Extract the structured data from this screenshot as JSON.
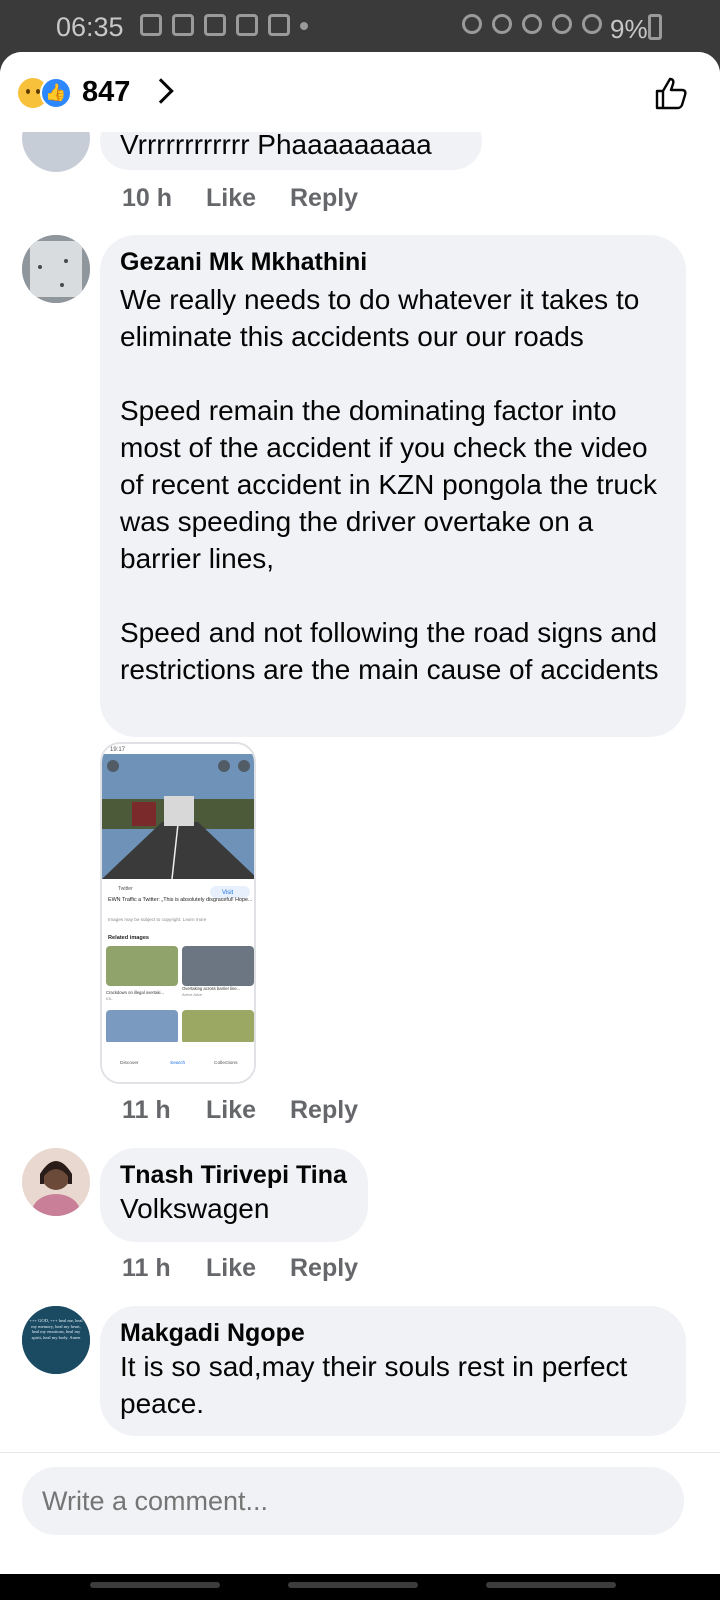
{
  "status_bar": {
    "time": "06:35",
    "battery": "9%"
  },
  "header": {
    "reaction_count": "847"
  },
  "comments": [
    {
      "name": "",
      "text": "Vrrrrrrrrrrrr Phaaaaaaaaa",
      "time": "10 h"
    },
    {
      "name": "Gezani Mk Mkhathini",
      "text": "We really needs to do whatever it takes to eliminate this accidents our our roads\n\nSpeed remain the dominating factor into most of the accident if you check the video of recent accident in KZN pongola the truck was speeding the driver overtake on a barrier lines,\n\nSpeed and not following the road signs and restrictions are the main cause of accidents",
      "time": "11 h"
    },
    {
      "name": "Tnash Tirivepi Tina",
      "text": "Volkswagen",
      "time": "11 h"
    },
    {
      "name": "Makgadi Ngope",
      "text": "It is so sad,may their souls rest in perfect peace."
    }
  ],
  "actions": {
    "like": "Like",
    "reply": "Reply"
  },
  "attachment": {
    "status_time": "19:17",
    "source": "Twitter",
    "caption": "EWN Traffic a Twitter: „This is absolutely disgraceful! Hope...",
    "visit": "Visit",
    "copyright": "Images may be subject to copyright. Learn more",
    "related_title": "Related images",
    "related_1": "Crackdown on illegal overtaki...",
    "related_1_src": "IOL",
    "related_2": "Overtaking across barrier line...",
    "related_2_src": "Arrive Alive",
    "nav_discover": "Discover",
    "nav_search": "Search",
    "nav_collections": "Collections"
  },
  "avatar_2_text": "+++ GOD, +++ heal me, heal my memory, heal my heart, heal my emotions, heal my spirit, heal my body. Amen",
  "composer": {
    "placeholder": "Write a comment..."
  }
}
